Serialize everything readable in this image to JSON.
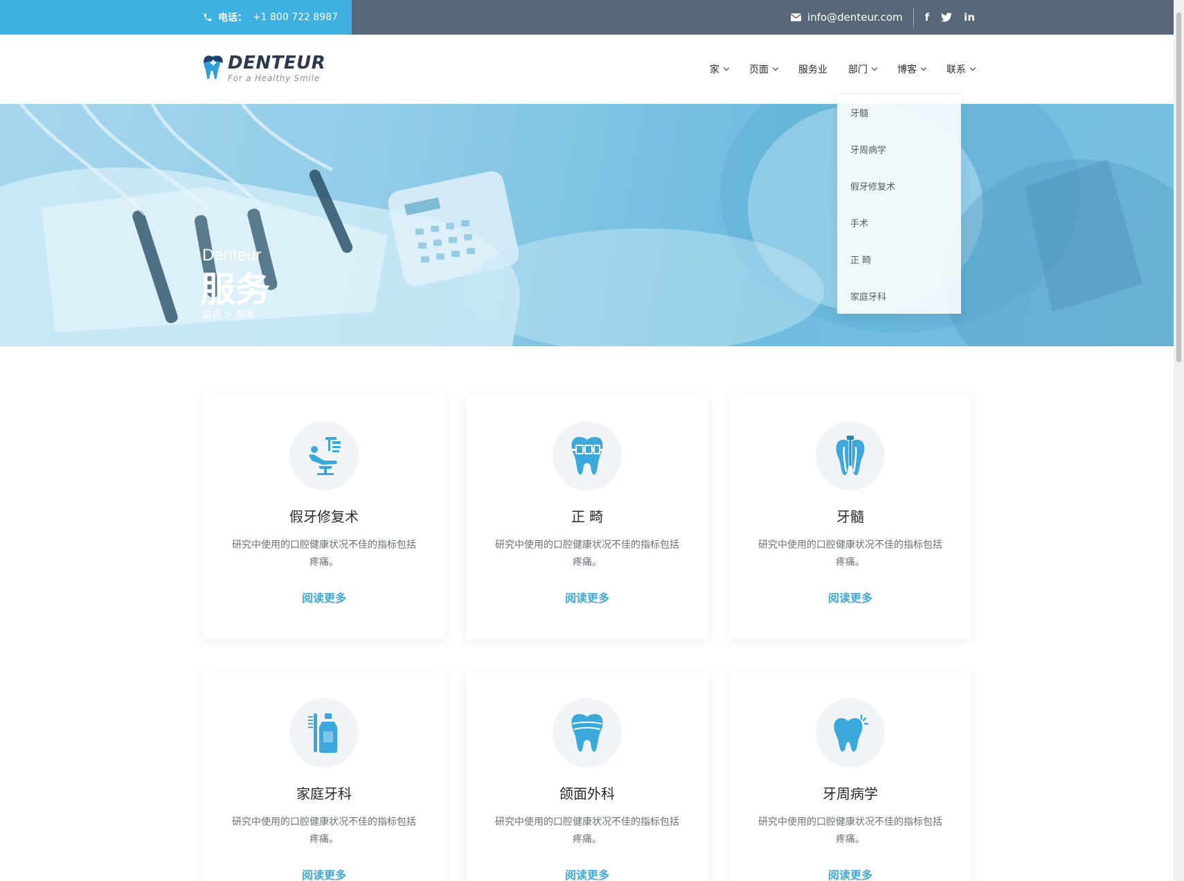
{
  "topbar": {
    "phone_label": "电话：",
    "phone_number": "+1 800 722 8987",
    "email": "info@denteur.com",
    "socials": [
      "f",
      "t",
      "in"
    ]
  },
  "logo": {
    "name": "DENTEUR",
    "tagline": "For a Healthy Smile"
  },
  "nav": {
    "items": [
      {
        "label": "家",
        "has_dropdown": true
      },
      {
        "label": "页面",
        "has_dropdown": true
      },
      {
        "label": "服务业",
        "has_dropdown": false
      },
      {
        "label": "部门",
        "has_dropdown": true
      },
      {
        "label": "博客",
        "has_dropdown": true
      },
      {
        "label": "联系",
        "has_dropdown": true
      }
    ]
  },
  "dropdown": {
    "items": [
      "牙髓",
      "牙周病学",
      "假牙修复术",
      "手术",
      "正 畸",
      "家庭牙科"
    ]
  },
  "hero": {
    "subtitle": "Denteur",
    "title": "服务",
    "breadcrumb_home": "首页",
    "breadcrumb_sep": ">",
    "breadcrumb_current": "服务"
  },
  "cards": [
    {
      "title": "假牙修复术",
      "desc": "研究中使用的口腔健康状况不佳的指标包括疼痛。",
      "link": "阅读更多",
      "icon": "dental-chair-icon"
    },
    {
      "title": "正 畸",
      "desc": "研究中使用的口腔健康状况不佳的指标包括疼痛。",
      "link": "阅读更多",
      "icon": "tooth-braces-icon"
    },
    {
      "title": "牙髓",
      "desc": "研究中使用的口腔健康状况不佳的指标包括疼痛。",
      "link": "阅读更多",
      "icon": "root-canal-icon"
    },
    {
      "title": "家庭牙科",
      "desc": "研究中使用的口腔健康状况不佳的指标包括疼痛。",
      "link": "阅读更多",
      "icon": "toothbrush-paste-icon"
    },
    {
      "title": "颌面外科",
      "desc": "研究中使用的口腔健康状况不佳的指标包括疼痛。",
      "link": "阅读更多",
      "icon": "tooth-crown-icon"
    },
    {
      "title": "牙周病学",
      "desc": "研究中使用的口腔健康状况不佳的指标包括疼痛。",
      "link": "阅读更多",
      "icon": "sparkle-tooth-icon"
    }
  ],
  "colors": {
    "accent": "#3fb1e0",
    "topbar": "#566778",
    "link": "#3fa9d9",
    "icon": "#3aa8db"
  }
}
